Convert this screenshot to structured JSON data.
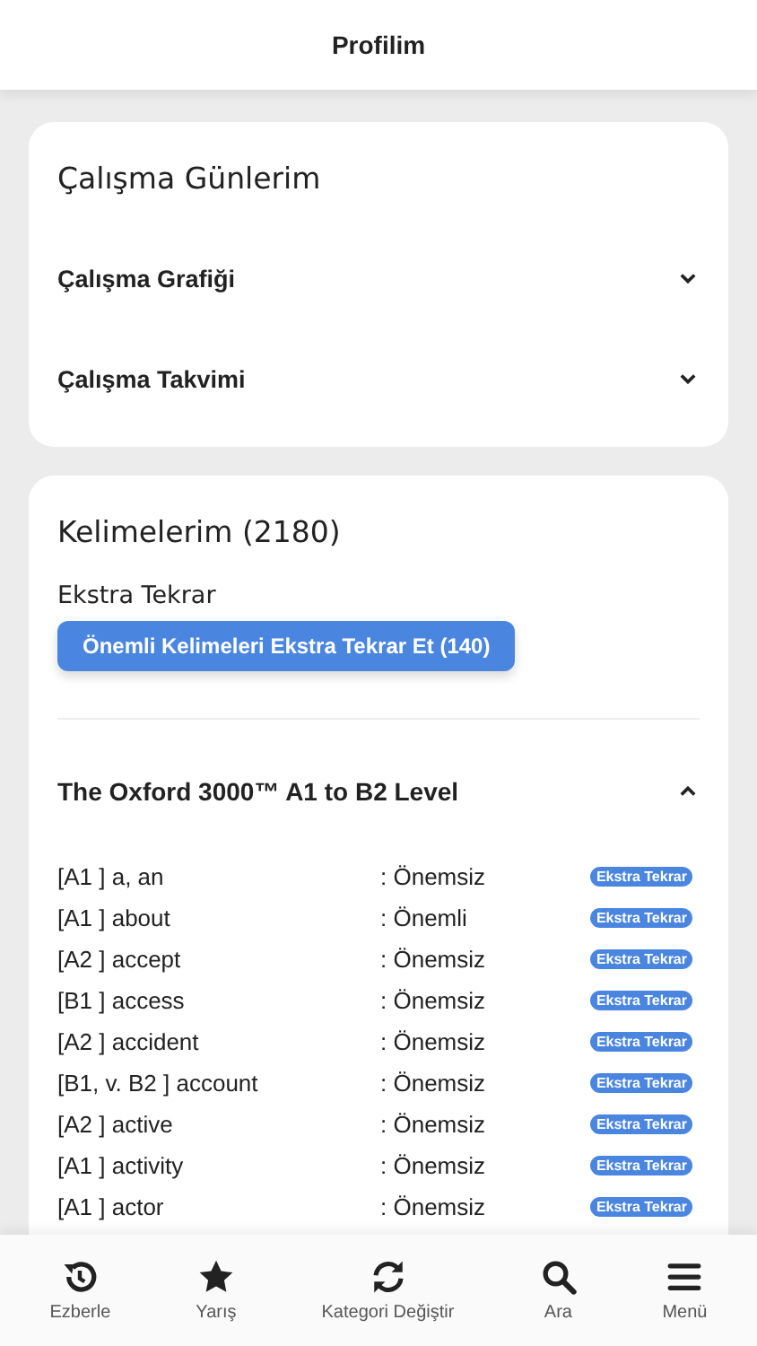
{
  "header": {
    "title": "Profilim"
  },
  "study_card": {
    "title": "Çalışma Günlerim",
    "sections": [
      {
        "label": "Çalışma Grafiği",
        "expanded": false
      },
      {
        "label": "Çalışma Takvimi",
        "expanded": false
      }
    ]
  },
  "words_card": {
    "title": "Kelimelerim (2180)",
    "extra_label": "Ekstra Tekrar",
    "extra_button": "Önemli Kelimeleri Ekstra Tekrar Et (140)",
    "list": {
      "title": "The Oxford 3000™ A1 to B2 Level",
      "expanded": true,
      "rows": [
        {
          "word": "[A1 ] a, an",
          "importance": ": Önemsiz",
          "action": "Ekstra Tekrar"
        },
        {
          "word": "[A1 ] about",
          "importance": ": Önemli",
          "action": "Ekstra Tekrar"
        },
        {
          "word": "[A2 ] accept",
          "importance": ": Önemsiz",
          "action": "Ekstra Tekrar"
        },
        {
          "word": "[B1 ] access",
          "importance": ": Önemsiz",
          "action": "Ekstra Tekrar"
        },
        {
          "word": "[A2 ] accident",
          "importance": ": Önemsiz",
          "action": "Ekstra Tekrar"
        },
        {
          "word": "[B1, v. B2 ] account",
          "importance": ": Önemsiz",
          "action": "Ekstra Tekrar"
        },
        {
          "word": "[A2 ] active",
          "importance": ": Önemsiz",
          "action": "Ekstra Tekrar"
        },
        {
          "word": "[A1 ] activity",
          "importance": ": Önemsiz",
          "action": "Ekstra Tekrar"
        },
        {
          "word": "[A1 ] actor",
          "importance": ": Önemsiz",
          "action": "Ekstra Tekrar"
        }
      ]
    }
  },
  "bottom_nav": [
    {
      "label": "Ezberle",
      "kind": "history"
    },
    {
      "label": "Yarış",
      "kind": "star"
    },
    {
      "label": "Kategori Değiştir",
      "kind": "refresh"
    },
    {
      "label": "Ara",
      "kind": "search"
    },
    {
      "label": "Menü",
      "kind": "menu"
    }
  ]
}
